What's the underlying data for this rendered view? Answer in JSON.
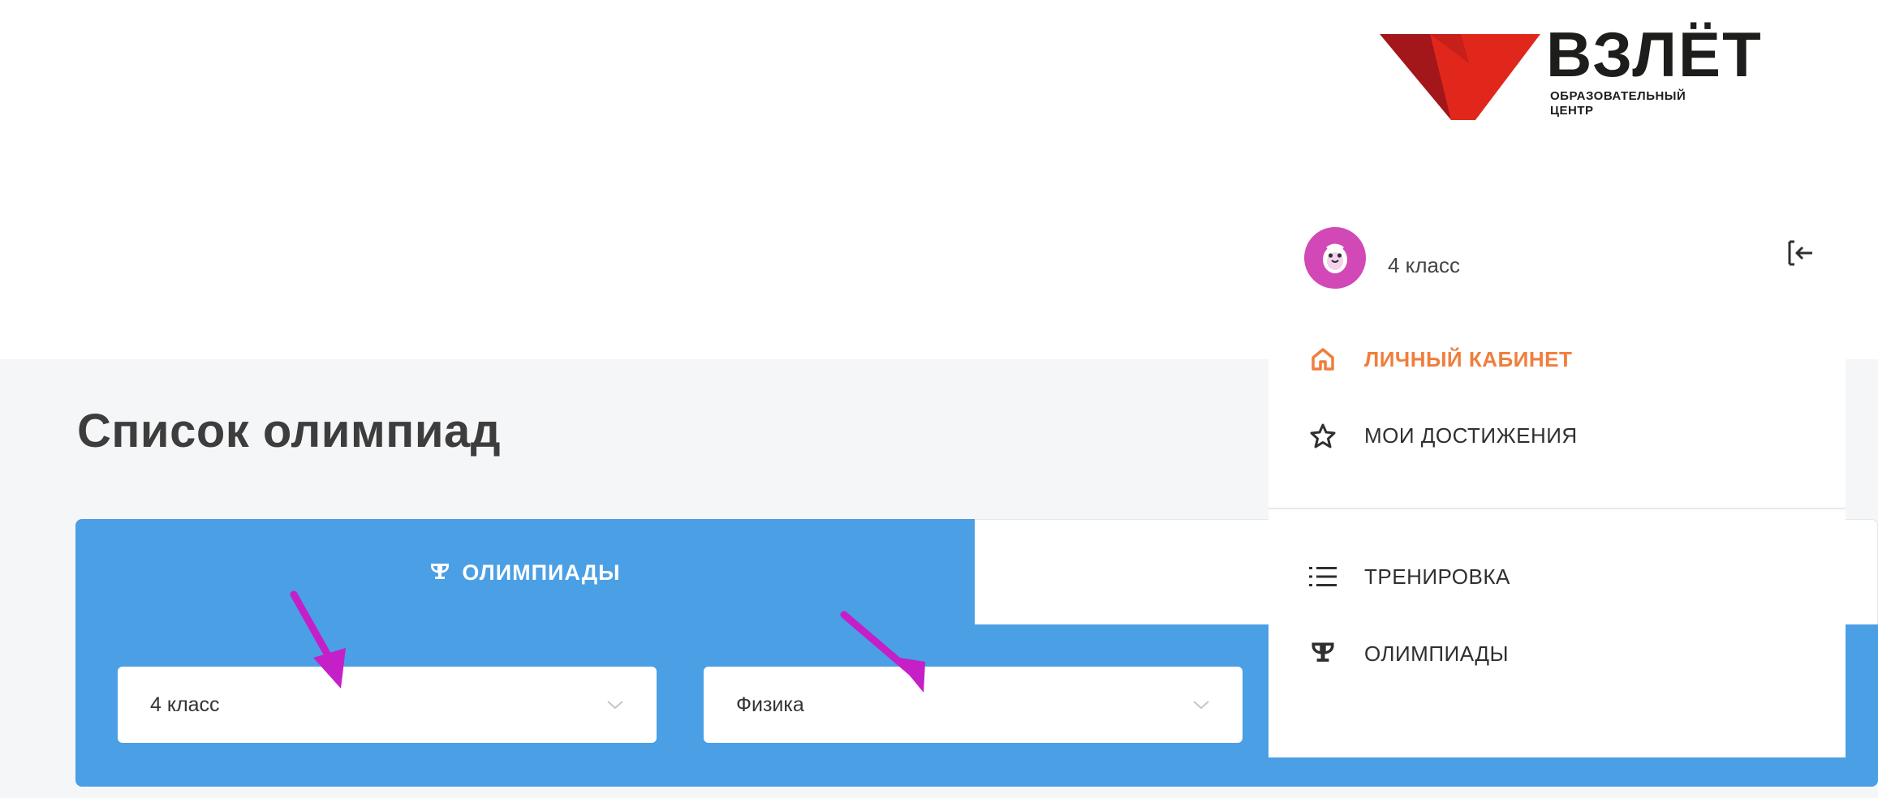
{
  "brand": {
    "name": "ВЗЛЁТ",
    "subtitle_line1": "ОБРАЗОВАТЕЛЬНЫЙ",
    "subtitle_line2": "ЦЕНТР",
    "colors": {
      "red": "#e1271b",
      "dark_red": "#a3161a",
      "text": "#1d1d1b"
    }
  },
  "page": {
    "title": "Список олимпиад",
    "background": "#f5f6f8"
  },
  "tabs": {
    "active_label": "ОЛИМПИАДЫ",
    "active_icon": "trophy-icon",
    "active_color": "#4b9fe5"
  },
  "filters": {
    "grade": {
      "value": "4 класс",
      "icon": "chevron-down-icon"
    },
    "subject": {
      "value": "Физика",
      "icon": "chevron-down-icon"
    }
  },
  "annotations": {
    "arrow_color": "#c51fc8"
  },
  "menu": {
    "user": {
      "grade": "4 класс",
      "avatar_icon": "penguin-avatar-icon",
      "logout_icon": "logout-icon",
      "avatar_color": "#d248b6"
    },
    "items": [
      {
        "label": "ЛИЧНЫЙ КАБИНЕТ",
        "icon": "home-icon",
        "active": true
      },
      {
        "label": "МОИ ДОСТИЖЕНИЯ",
        "icon": "star-icon",
        "active": false
      },
      {
        "label": "ТРЕНИРОВКА",
        "icon": "list-icon",
        "active": false
      },
      {
        "label": "ОЛИМПИАДЫ",
        "icon": "trophy-icon",
        "active": false
      }
    ],
    "active_color": "#f07e3c"
  }
}
